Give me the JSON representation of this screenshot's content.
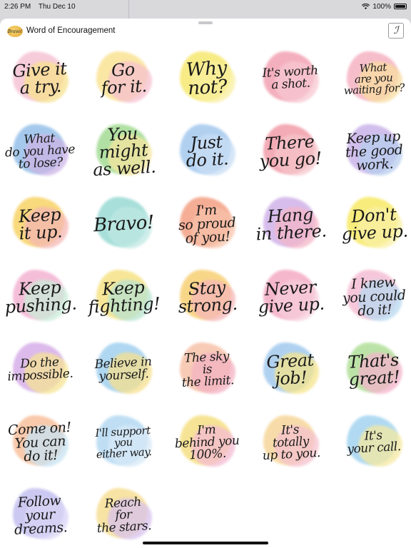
{
  "status_bar": {
    "time": "2:26 PM",
    "date": "Thu Dec 10",
    "battery": "100%"
  },
  "header": {
    "logo_text": "Bravo!",
    "title": "Word of Encouragement",
    "action_icon": "feather-icon",
    "action_glyph": "ℐ"
  },
  "stickers": [
    {
      "text": "Give it\na try.",
      "colors": [
        "#f6c7d6",
        "#f8e18d"
      ]
    },
    {
      "text": "Go\nfor it.",
      "colors": [
        "#fbe59b",
        "#f6c0cf"
      ]
    },
    {
      "text": "Why not?",
      "colors": [
        "#f7e978",
        "#f9ef9f"
      ]
    },
    {
      "text": "It's worth\na shot.",
      "colors": [
        "#f3a7b7",
        "#f7c7d1"
      ]
    },
    {
      "text": "What\nare you\nwaiting for?",
      "colors": [
        "#f6b7c6",
        "#f8dca0"
      ]
    },
    {
      "text": "What\ndo you have\nto lose?",
      "colors": [
        "#9cc4ea",
        "#cdb4e6"
      ]
    },
    {
      "text": "You might\nas well.",
      "colors": [
        "#a8dd9a",
        "#f6e6a0"
      ]
    },
    {
      "text": "Just\ndo it.",
      "colors": [
        "#a9ccef",
        "#c9def5"
      ]
    },
    {
      "text": "There\nyou go!",
      "colors": [
        "#f2a2ad",
        "#f6c5cb"
      ]
    },
    {
      "text": "Keep up\nthe good\nwork.",
      "colors": [
        "#cdb8ea",
        "#b7cdee"
      ]
    },
    {
      "text": "Keep\nit up.",
      "colors": [
        "#f8d56e",
        "#f5b7b4"
      ]
    },
    {
      "text": "Bravo!",
      "colors": [
        "#9fdcd6",
        "#bfe8e3"
      ]
    },
    {
      "text": "I'm\nso proud\nof you!",
      "colors": [
        "#f4a58a",
        "#f7c2a9"
      ]
    },
    {
      "text": "Hang\nin there.",
      "colors": [
        "#d3b6ea",
        "#f4b6c8"
      ]
    },
    {
      "text": "Don't\ngive up.",
      "colors": [
        "#f8ea6e",
        "#faf1a5"
      ]
    },
    {
      "text": "Keep\npushing.",
      "colors": [
        "#f4b7d4",
        "#c9ecd8"
      ]
    },
    {
      "text": "Keep\nfighting!",
      "colors": [
        "#f7e48c",
        "#b7e3cf"
      ]
    },
    {
      "text": "Stay\nstrong.",
      "colors": [
        "#f8d27c",
        "#f6b6b8"
      ]
    },
    {
      "text": "Never\ngive up.",
      "colors": [
        "#f5b0c6",
        "#f7cddb"
      ]
    },
    {
      "text": "I knew\nyou could\ndo it!",
      "colors": [
        "#f6c2d6",
        "#b8d9ef"
      ]
    },
    {
      "text": "Do the\nimpossible.",
      "colors": [
        "#d9b3ea",
        "#f6e494"
      ]
    },
    {
      "text": "Believe in\nyourself.",
      "colors": [
        "#a7d3f0",
        "#f6e08e"
      ]
    },
    {
      "text": "The sky\nis\nthe limit.",
      "colors": [
        "#f7c6ae",
        "#f4b2c3"
      ]
    },
    {
      "text": "Great\njob!",
      "colors": [
        "#a7cdee",
        "#f6e58c"
      ]
    },
    {
      "text": "That's\ngreat!",
      "colors": [
        "#b5e19e",
        "#f4b3cb"
      ]
    },
    {
      "text": "Come on!\nYou can\ndo it!",
      "colors": [
        "#f8c4a2",
        "#c7e3f2"
      ]
    },
    {
      "text": "I'll support\nyou\neither way.",
      "colors": [
        "#b9dbf3",
        "#d7e9f7"
      ]
    },
    {
      "text": "I'm\nbehind you\n100%.",
      "colors": [
        "#f6e18a",
        "#f4bcd3"
      ]
    },
    {
      "text": "It's\ntotally\nup to you.",
      "colors": [
        "#f7d9a0",
        "#f5c2cf"
      ]
    },
    {
      "text": "It's\nyour call.",
      "colors": [
        "#a9d7f1",
        "#f6e9a0"
      ]
    },
    {
      "text": "Follow\nyour\ndreams.",
      "colors": [
        "#c6c3f0",
        "#d9d5f6"
      ]
    },
    {
      "text": "Reach\nfor\nthe stars.",
      "colors": [
        "#f7e09a",
        "#d8c2ee"
      ]
    }
  ]
}
